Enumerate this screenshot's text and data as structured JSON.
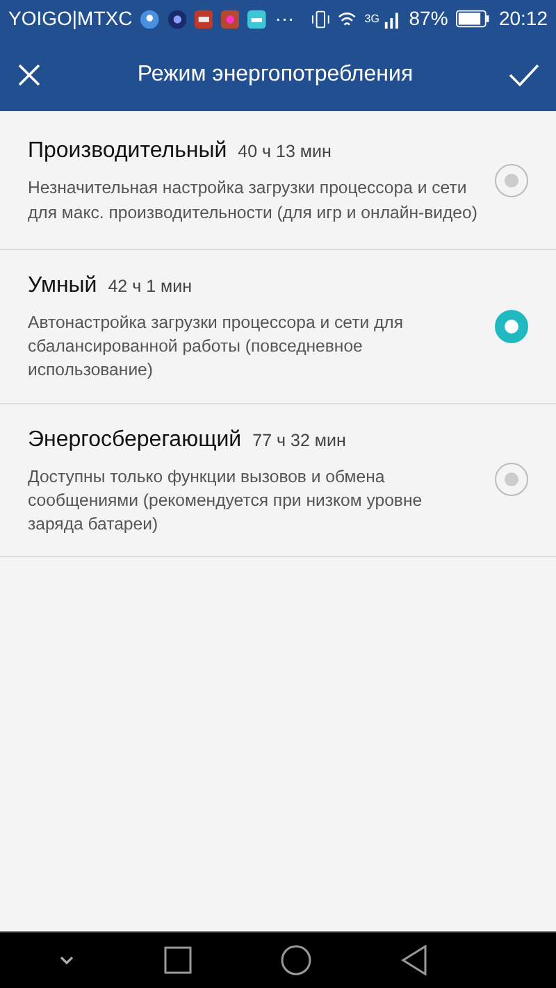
{
  "status_bar": {
    "carrier": "YOIGO|MTXC",
    "more": "···",
    "network": "3G",
    "battery": "87%",
    "time": "20:12"
  },
  "app_bar": {
    "title": "Режим энергопотребления"
  },
  "modes": [
    {
      "name": "Производительный",
      "time": "40 ч 13 мин",
      "description": "Незначительная настройка загрузки процессора и сети для макс. производительности (для игр и онлайн-видео)",
      "selected": false
    },
    {
      "name": "Умный",
      "time": "42 ч 1 мин",
      "description": "Автонастройка загрузки процессора и сети для сбалансированной работы (повседневное использование)",
      "selected": true
    },
    {
      "name": "Энергосберегающий",
      "time": "77 ч 32 мин",
      "description": "Доступны только функции вызовов и обмена сообщениями (рекомендуется при низком уровне заряда батареи)",
      "selected": false
    }
  ]
}
